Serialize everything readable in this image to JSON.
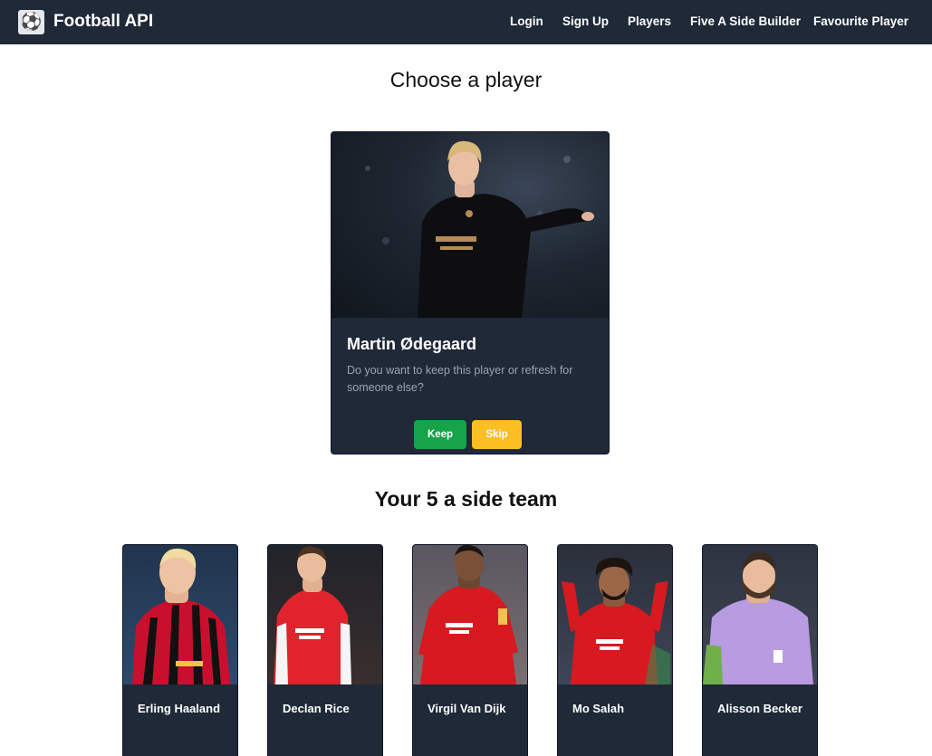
{
  "navbar": {
    "brand_icon": "soccer-ball-icon",
    "brand_name": "Football API",
    "links": [
      "Login",
      "Sign Up",
      "Players",
      "Five A Side Builder",
      "Favourite Player"
    ]
  },
  "chooser": {
    "heading": "Choose a player",
    "player_name": "Martin Ødegaard",
    "prompt": "Do you want to keep this player or refresh for someone else?",
    "keep_label": "Keep",
    "skip_label": "Skip"
  },
  "team": {
    "heading": "Your 5 a side team",
    "players": [
      {
        "name": "Erling Haaland"
      },
      {
        "name": "Declan Rice"
      },
      {
        "name": "Virgil Van Dijk"
      },
      {
        "name": "Mo Salah"
      },
      {
        "name": "Alisson Becker"
      }
    ]
  },
  "colors": {
    "navbar": "#1f2937",
    "card": "#1f2937",
    "keep": "#16a34a",
    "skip": "#fbbf24",
    "muted_text": "#9ca3af"
  }
}
